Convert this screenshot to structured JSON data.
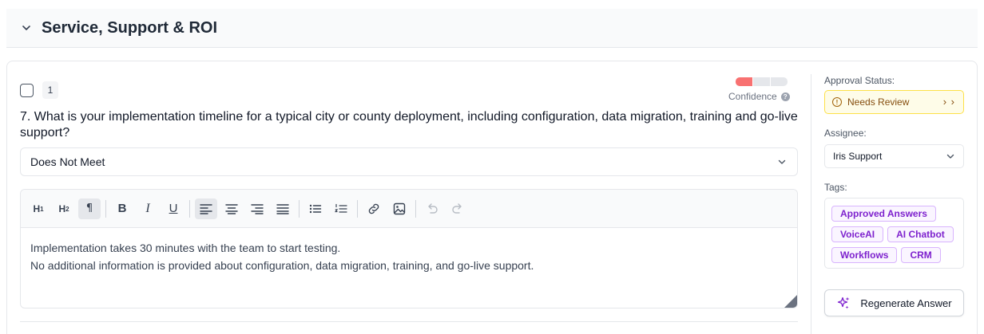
{
  "section": {
    "title": "Service, Support & ROI",
    "chevron_icon": "chevron-down-icon"
  },
  "question": {
    "number_badge": "1",
    "text": "7. What is your implementation timeline for a typical city or county deployment, including configuration, data migration, training and go-live support?",
    "confidence": {
      "label": "Confidence",
      "level": 1,
      "max": 3,
      "fill_color": "#f87171",
      "empty_color": "#e5e7eb"
    },
    "compliance": {
      "selected": "Does Not Meet"
    },
    "editor": {
      "toolbar": [
        "heading-1",
        "heading-2",
        "paragraph",
        "bold",
        "italic",
        "underline",
        "align-left",
        "align-center",
        "align-right",
        "align-justify",
        "bullet-list",
        "ordered-list",
        "link",
        "image",
        "undo",
        "redo"
      ],
      "lines": [
        "Implementation takes 30 minutes with the team to start testing.",
        "No additional information is provided about configuration, data migration, training, and go-live support."
      ]
    }
  },
  "sidebar": {
    "approval_label": "Approval Status:",
    "approval_status": "Needs Review",
    "approval_color": "#fefce8",
    "assignee_label": "Assignee:",
    "assignee": "Iris Support",
    "tags_label": "Tags:",
    "tags": [
      "Approved Answers",
      "VoiceAI",
      "AI Chatbot",
      "Workflows",
      "CRM"
    ],
    "regenerate_label": "Regenerate Answer"
  }
}
